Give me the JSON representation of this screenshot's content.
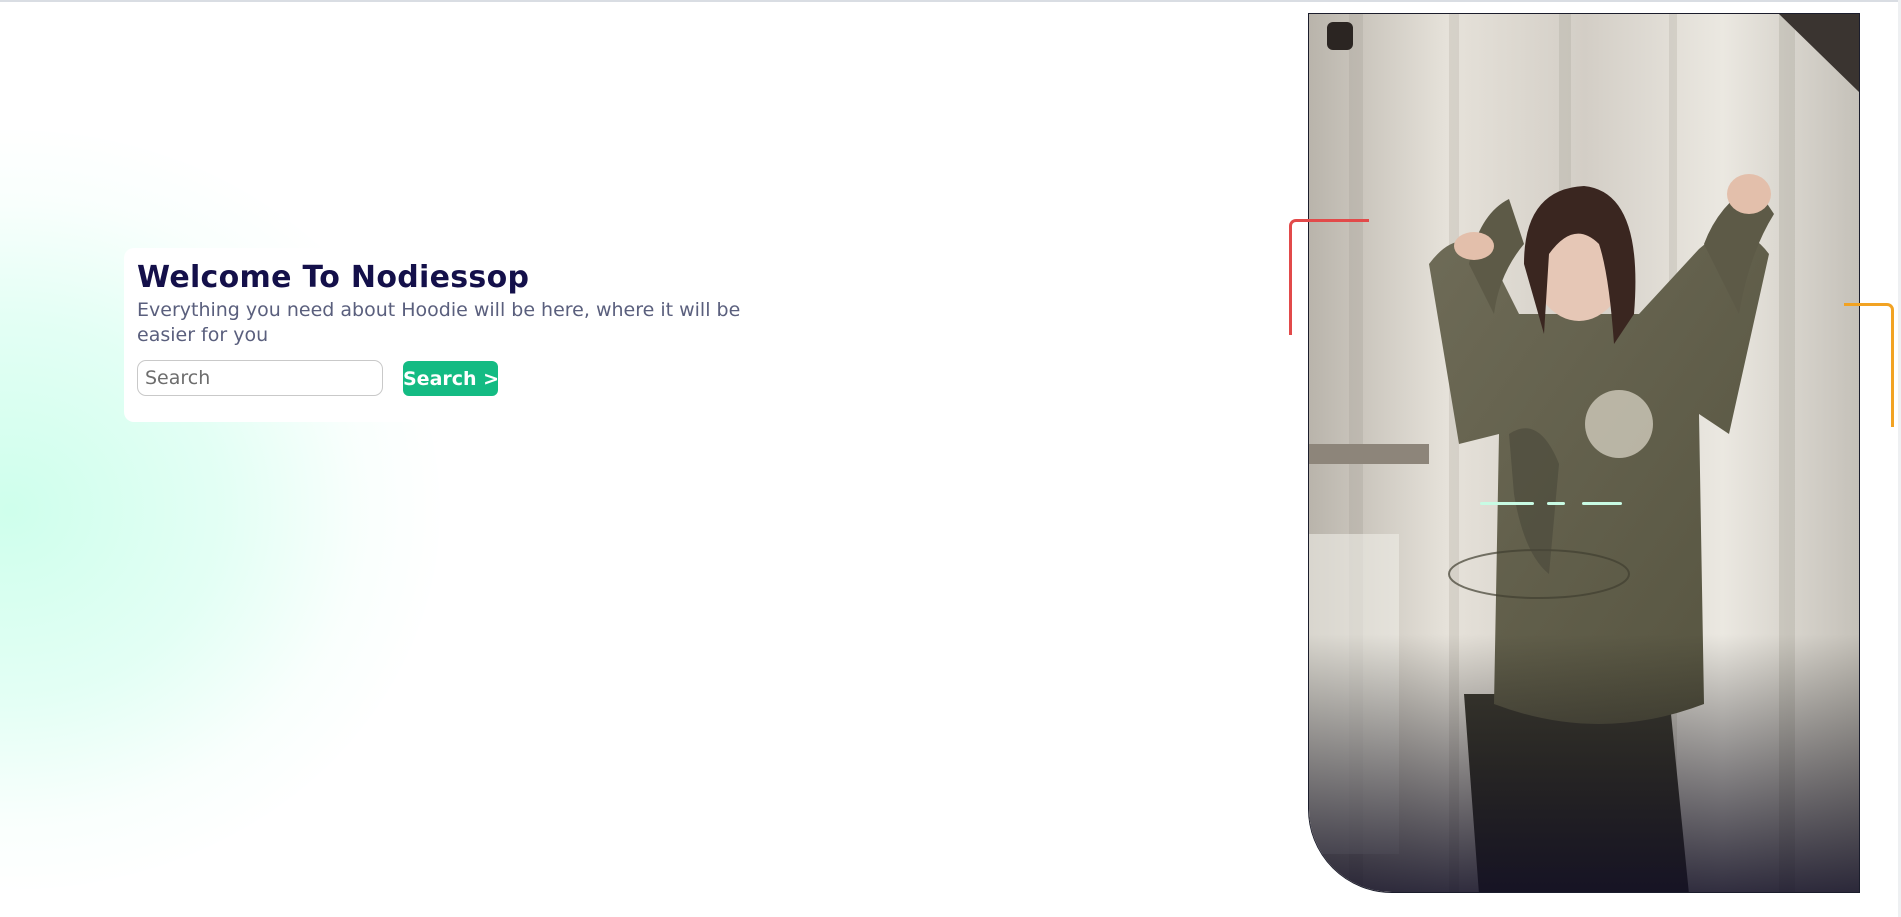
{
  "hero": {
    "title": "Welcome To Nodiessop",
    "subtitle": "Everything you need about Hoodie will be here, where it will be easier for you"
  },
  "search": {
    "placeholder": "Search",
    "value": "",
    "button_label": "Search >"
  },
  "colors": {
    "title": "#14104a",
    "subtitle": "#5a5f7d",
    "button": "#14bb83",
    "mint": "#ccffeb",
    "accent_red": "#e24a4a",
    "accent_orange": "#f2a323"
  },
  "photo": {
    "subject": "hoodie-model-photo"
  }
}
